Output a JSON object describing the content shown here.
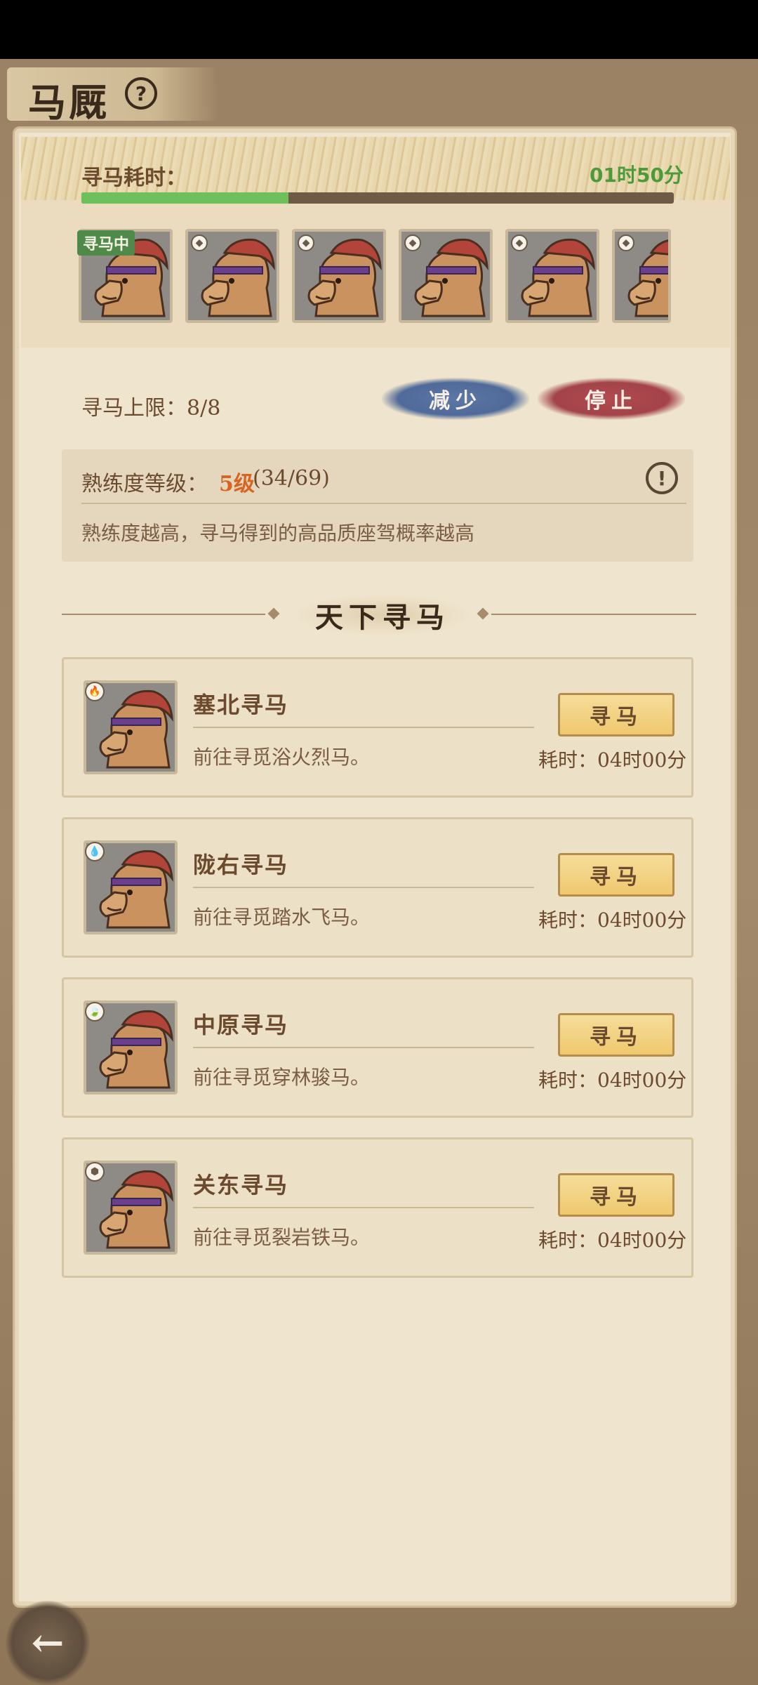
{
  "header": {
    "title": "马厩",
    "help_icon": "?"
  },
  "search_status": {
    "time_label": "寻马耗时：",
    "time_value": "01时50分",
    "progress": 0.35,
    "slots": [
      {
        "tag": "寻马中",
        "element": "water"
      },
      {
        "tag": "",
        "element": "water"
      },
      {
        "tag": "",
        "element": "water"
      },
      {
        "tag": "",
        "element": "water"
      },
      {
        "tag": "",
        "element": "water"
      },
      {
        "tag": "",
        "element": "water"
      }
    ]
  },
  "controls": {
    "limit_label": "寻马上限：8/8",
    "decrease_label": "减少",
    "stop_label": "停止"
  },
  "proficiency": {
    "label": "熟练度等级：",
    "level": "5级",
    "progress": "(34/69)",
    "description": "熟练度越高，寻马得到的高品质座驾概率越高",
    "info_icon": "!"
  },
  "section_title": "天下寻马",
  "regions": [
    {
      "title": "塞北寻马",
      "desc": "前往寻觅浴火烈马。",
      "button": "寻马",
      "time": "耗时：04时00分",
      "element": "fire",
      "element_glyph": "🔥"
    },
    {
      "title": "陇右寻马",
      "desc": "前往寻觅踏水飞马。",
      "button": "寻马",
      "time": "耗时：04时00分",
      "element": "water",
      "element_glyph": "💧"
    },
    {
      "title": "中原寻马",
      "desc": "前往寻觅穿林骏马。",
      "button": "寻马",
      "time": "耗时：04时00分",
      "element": "wood",
      "element_glyph": "🍃"
    },
    {
      "title": "关东寻马",
      "desc": "前往寻觅裂岩铁马。",
      "button": "寻马",
      "time": "耗时：04时00分",
      "element": "rock",
      "element_glyph": "⬢"
    }
  ],
  "nav": {
    "back_glyph": "←"
  },
  "colors": {
    "accent_green": "#4c9a3a",
    "level_orange": "#d8641f",
    "button_gold": "#efc86e"
  }
}
